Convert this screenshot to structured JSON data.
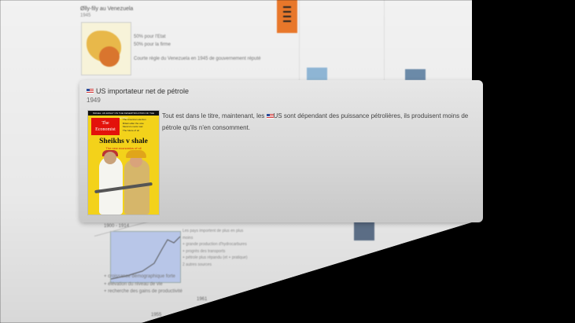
{
  "background_page": {
    "top_card": {
      "title": "Ølly-fily au Venezuela",
      "year": "1945",
      "text_lines": [
        "50% pour l'Etat",
        "50% pour la firme",
        "Courte règle du Venezuela en 1945 de gouvernement réputé"
      ]
    },
    "bottom_card": {
      "heading": "1900 - 1914",
      "list": [
        "+ croissance démographique forte",
        "+ élévation du niveau de vie",
        "+ recherche des gains de productivité"
      ],
      "side_list": [
        "Les pays importent de plus en plus",
        "moins",
        "+ grande production d'hydrocarbures",
        "+ progrès des transports",
        "+ pétrole plus répandu (et + pratique)",
        "2 autres sources"
      ]
    },
    "date_labels": [
      "1955",
      "1961"
    ]
  },
  "popup": {
    "title": "US  importateur net de pétrole",
    "year": "1949",
    "description_before_flag": "Tout est dans le titre, maintenant, les ",
    "description_after_flag": "US  sont dépendant des puissance pétrolières, ils produisent moins de pétrole qu'ils n'en consomment.",
    "cover": {
      "top_banner": "ISRAEL: AN ESSAY ON THE DESERTIFICATION OF THE WORLD",
      "logo_line1": "The",
      "logo_line2": "Economist",
      "side_list": [
        "The American election",
        "Britain after the vote",
        "Mexico's narco war",
        "The future of oil"
      ],
      "headline": "Sheikhs v shale",
      "subhead": "The new economics of oil"
    }
  },
  "colors": {
    "accent_orange": "#e8772a",
    "economist_red": "#e3120b",
    "cover_yellow": "#f3d21a"
  }
}
